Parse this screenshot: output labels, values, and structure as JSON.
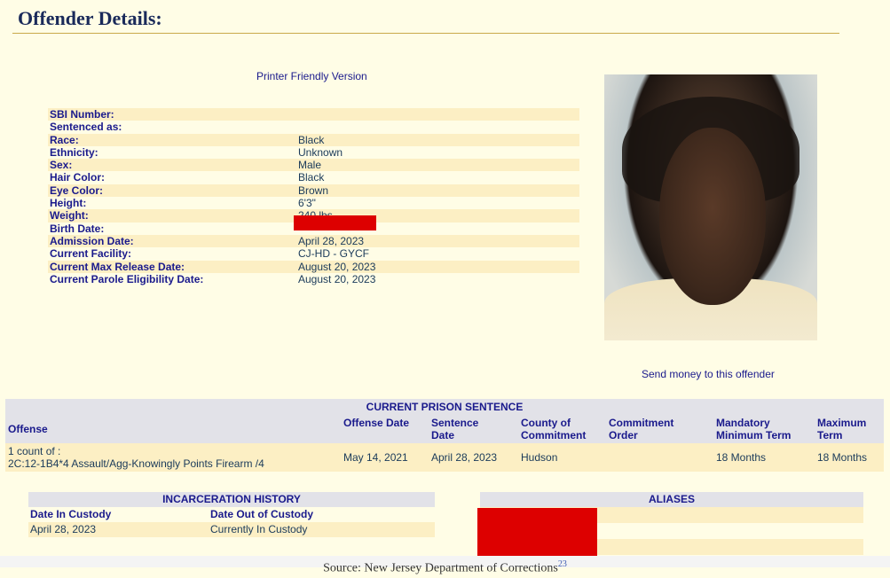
{
  "page_title": "Offender Details:",
  "printer_link": "Printer Friendly Version",
  "details": [
    {
      "label": "SBI Number:",
      "value": ""
    },
    {
      "label": "Sentenced as:",
      "value": ""
    },
    {
      "label": "Race:",
      "value": "Black"
    },
    {
      "label": "Ethnicity:",
      "value": "Unknown"
    },
    {
      "label": "Sex:",
      "value": "Male"
    },
    {
      "label": "Hair Color:",
      "value": "Black"
    },
    {
      "label": "Eye Color:",
      "value": "Brown"
    },
    {
      "label": "Height:",
      "value": "6'3\""
    },
    {
      "label": "Weight:",
      "value": "240 lbs."
    },
    {
      "label": "Birth Date:",
      "value": ""
    },
    {
      "label": "Admission Date:",
      "value": "April 28, 2023"
    },
    {
      "label": "Current Facility:",
      "value": "CJ-HD - GYCF"
    },
    {
      "label": "Current Max Release Date:",
      "value": "August 20, 2023"
    },
    {
      "label": "Current Parole Eligibility Date:",
      "value": "August 20, 2023"
    }
  ],
  "send_money_link": "Send money to this offender",
  "sentence": {
    "heading": "CURRENT PRISON SENTENCE",
    "columns": [
      "Offense",
      "Offense Date",
      "Sentence Date",
      "County of Commitment",
      "Commitment Order",
      "Mandatory Minimum Term",
      "Maximum Term"
    ],
    "row": {
      "offense_line1": "1 count of :",
      "offense_line2": "2C:12-1B4*4 Assault/Agg-Knowingly Points Firearm /4",
      "offense_date": "May 14, 2021",
      "sentence_date": "April 28, 2023",
      "county": "Hudson",
      "order": "",
      "min_term": "18 Months",
      "max_term": "18 Months"
    }
  },
  "history": {
    "heading": "INCARCERATION HISTORY",
    "col_in": "Date In Custody",
    "col_out": "Date Out of Custody",
    "date_in": "April 28, 2023",
    "date_out": "Currently In Custody"
  },
  "aliases": {
    "heading": "ALIASES"
  },
  "source": {
    "text": "Source: New Jersey Department of Corrections",
    "ref": "23"
  },
  "colors": {
    "background": "#fffde6",
    "stripe": "#fcefc4",
    "header_bg": "#e2e2e8",
    "link": "#1a1a8c",
    "redaction": "#dd0000"
  }
}
